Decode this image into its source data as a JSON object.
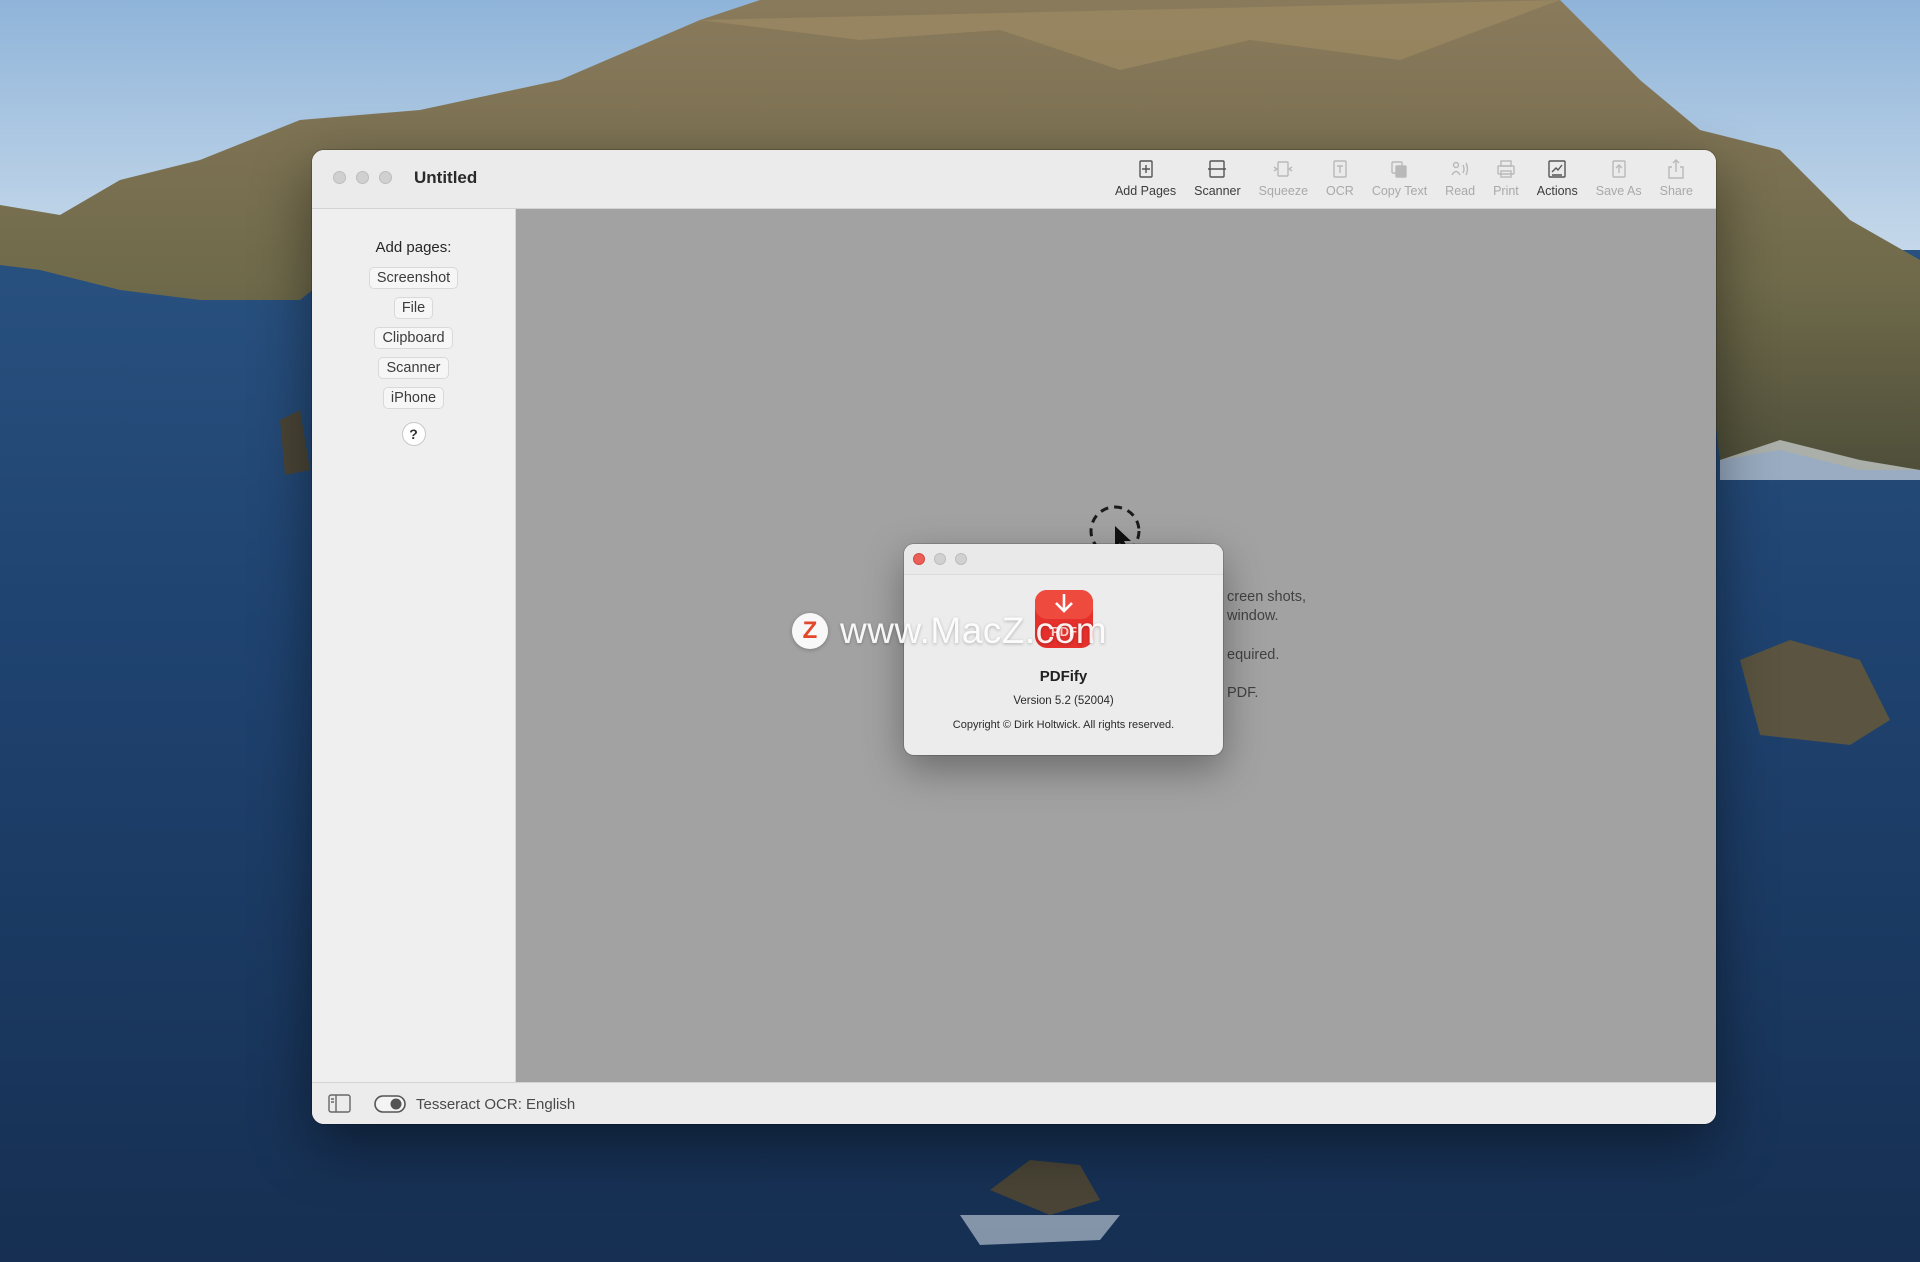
{
  "window": {
    "title": "Untitled"
  },
  "toolbar": {
    "items": [
      {
        "label": "Add Pages",
        "icon": "add-pages-icon",
        "enabled": true
      },
      {
        "label": "Scanner",
        "icon": "scanner-icon",
        "enabled": true
      },
      {
        "label": "Squeeze",
        "icon": "squeeze-icon",
        "enabled": false
      },
      {
        "label": "OCR",
        "icon": "ocr-icon",
        "enabled": false
      },
      {
        "label": "Copy Text",
        "icon": "copy-text-icon",
        "enabled": false
      },
      {
        "label": "Read",
        "icon": "read-aloud-icon",
        "enabled": false
      },
      {
        "label": "Print",
        "icon": "printer-icon",
        "enabled": false
      },
      {
        "label": "Actions",
        "icon": "actions-icon",
        "enabled": true
      },
      {
        "label": "Save As",
        "icon": "save-as-icon",
        "enabled": false
      },
      {
        "label": "Share",
        "icon": "share-icon",
        "enabled": false
      }
    ]
  },
  "sidebar": {
    "heading": "Add pages:",
    "buttons": [
      "Screenshot",
      "File",
      "Clipboard",
      "Scanner",
      "iPhone"
    ],
    "help": "?"
  },
  "content": {
    "hint_lines": [
      "creen shots,",
      "window.",
      "equired.",
      "PDF."
    ]
  },
  "statusbar": {
    "ocr_label": "Tesseract OCR: English"
  },
  "about": {
    "app_name": "PDFify",
    "version": "Version 5.2 (52004)",
    "copyright": "Copyright © Dirk Holtwick. All rights reserved.",
    "icon_text": "PDF"
  },
  "watermark": {
    "logo": "Z",
    "text": "www.MacZ.com"
  },
  "colors": {
    "content_bg": "#a2a2a2",
    "app_icon_red": "#e5302c",
    "close_red": "#ec5f57"
  }
}
